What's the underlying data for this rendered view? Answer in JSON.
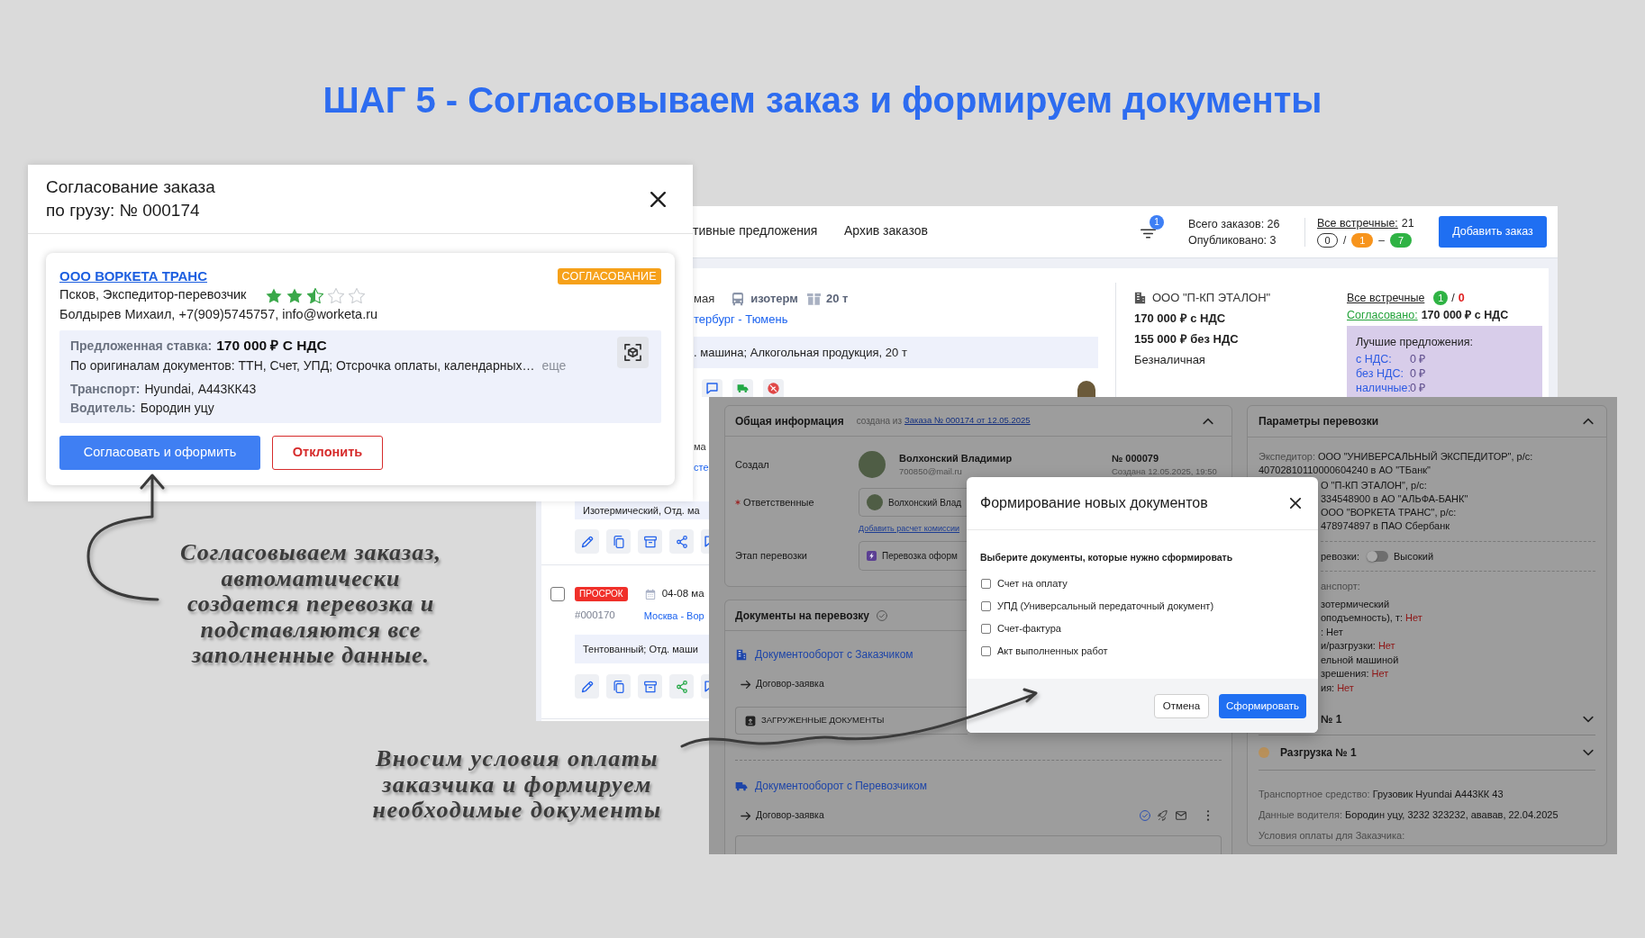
{
  "title": "ШАГ 5 - Согласовываем заказ и формируем документы",
  "approval_dialog": {
    "title": "Согласование заказа\nпо грузу: № 000174",
    "offer": {
      "company": "ООО ВОРКЕТА ТРАНС",
      "status": "СОГЛАСОВАНИЕ",
      "description": "Псков, Экспедитор-перевозчик",
      "stars": 2.5,
      "contact": "Болдырев Михаил, +7(909)5745757, info@worketa.ru",
      "rate_label": "Предложенная ставка:",
      "rate": "170 000 ₽ С НДС",
      "terms": "По оригиналам документов: ТТН, Счет, УПД; Отсрочка оплаты, календарных…",
      "more": "еще",
      "details": [
        {
          "label": "Транспорт:",
          "value": "Hyundai, А443КК43"
        },
        {
          "label": "Водитель:",
          "value": "Бородин уцу"
        }
      ]
    },
    "buttons": [
      {
        "label": "Согласовать и оформить",
        "kind": "primary"
      },
      {
        "label": "Отклонить",
        "kind": "danger"
      }
    ]
  },
  "orders_page": {
    "tabs": [
      {
        "label": "тивные предложения",
        "selected": false
      },
      {
        "label": "Архив заказов",
        "selected": false
      }
    ],
    "filter_count": "1",
    "stats": [
      "Всего заказов: 26",
      "Опубликовано: 3"
    ],
    "counter_offers": {
      "label": "Все встречные:",
      "count": "21",
      "chips": [
        {
          "kind": "outline",
          "value": "0"
        },
        {
          "kind": "separator",
          "value": "/"
        },
        {
          "kind": "filled",
          "value": "1",
          "color": "#f7941d"
        },
        {
          "kind": "separator",
          "value": "–"
        },
        {
          "kind": "filled",
          "value": "7",
          "color": "#2fb344"
        }
      ]
    },
    "add_button": "Добавить заказ",
    "order": {
      "date": "мая",
      "body_type": "изотерм",
      "capacity": "20 т",
      "route": "тербург - Тюмень",
      "cargo": ". машина; Алкогольная продукция, 20 т",
      "actions": [
        {
          "kind": "chat"
        },
        {
          "kind": "truck"
        },
        {
          "kind": "cancel"
        }
      ],
      "customer": "ООО \"П-КП ЭТАЛОН\"",
      "prices": [
        "170 000 ₽ с НДС",
        "155 000 ₽ без НДС"
      ],
      "payment": "Безналичная",
      "counters": {
        "label": "Все встречные",
        "accepted": "1",
        "separator": "/",
        "rejected": "0"
      },
      "agreed": {
        "label": "Согласовано:",
        "value": "170 000 ₽ с НДС"
      },
      "best_offers": {
        "title": "Лучшие предложения:",
        "rows": [
          {
            "label": "с НДС:",
            "value": "0 ₽"
          },
          {
            "label": "без НДС:",
            "value": "0 ₽"
          },
          {
            "label": "наличные:",
            "value": "0 ₽"
          }
        ]
      }
    },
    "order_fragment": {
      "date": "ма",
      "route": "сте",
      "cargo": "Изотермический, Отд. ма",
      "actions": [
        {
          "kind": "edit",
          "highlighted": false
        },
        {
          "kind": "copy",
          "highlighted": false
        },
        {
          "kind": "archive",
          "highlighted": false
        },
        {
          "kind": "share",
          "highlighted": false
        },
        {
          "kind": "chat",
          "highlighted": false
        }
      ]
    },
    "overdue_order": {
      "checked": false,
      "status": "ПРОСРОК",
      "date": "04-08 ма",
      "number": "#000170",
      "route": "Москва - Вор",
      "cargo": "Тентованный; Отд. маши",
      "actions": [
        {
          "kind": "edit",
          "highlighted": false
        },
        {
          "kind": "copy",
          "highlighted": false
        },
        {
          "kind": "archive",
          "highlighted": false
        },
        {
          "kind": "share",
          "highlighted": true
        },
        {
          "kind": "chat",
          "highlighted": false
        }
      ]
    }
  },
  "transport_page": {
    "general_info": {
      "title": "Общая информация",
      "expanded": true,
      "source_prefix": "создана из",
      "source_link": "Заказа № 000174 от 12.05.2025",
      "creator_label": "Создал",
      "creator_name": "Волхонский Владимир",
      "creator_email": "700850@mail.ru",
      "number": "№ 000079",
      "created": "Создана 12.05.2025, 19:50",
      "responsible_label": "Ответственные",
      "required": true,
      "responsible": "Волхонский Влад",
      "add_commission": "Добавить расчет комиссии",
      "stage_label": "Этап перевозки",
      "stage": "Перевозка оформ"
    },
    "documents": {
      "title": "Документы на перевозку",
      "groups": [
        {
          "kind": "customer",
          "title": "Документооборот с Заказчиком",
          "items": [
            "Договор-заявка"
          ],
          "uploads": "ЗАГРУЖЕННЫЕ ДОКУМЕНТЫ"
        },
        {
          "kind": "carrier",
          "title": "Документооборот с Перевозчиком",
          "items": [
            "Договор-заявка"
          ]
        }
      ]
    },
    "params": {
      "title": "Параметры перевозки",
      "expanded": true,
      "expeditor": {
        "label": "Экспедитор:",
        "lines": [
          "ООО \"УНИВЕРСАЛЬНЫЙ ЭКСПЕДИТОР\", р/с:",
          "40702810110000604240 в АО \"ТБанк\""
        ]
      },
      "account_lines": [
        "О \"П-КП ЭТАЛОН\", р/с:",
        "334548900 в АО \"АЛЬФА-БАНК\"",
        "ООО \"ВОРКЕТА ТРАНС\", р/с:",
        "478974897 в ПАО Сбербанк"
      ],
      "priority": {
        "label": "ревозки:",
        "on": false,
        "value": "Высокий"
      },
      "transport_label": "анспорт:",
      "transport_lines": [
        {
          "text": "зотермический"
        },
        {
          "text": "оподъемность), т:",
          "value": "Нет",
          "warning": true
        },
        {
          "text": ":",
          "value": "Нет",
          "warning": false
        },
        {
          "text": "и/разгрузки:",
          "value": "Нет",
          "warning": true
        },
        {
          "text": "ельной машиной"
        },
        {
          "text": "зрешения:",
          "value": "Нет",
          "warning": true
        },
        {
          "text": "ия:",
          "value": "Нет",
          "warning": true
        }
      ],
      "stops": [
        {
          "title": "№ 1",
          "expanded": false
        },
        {
          "title": "Разгрузка № 1",
          "expanded": false,
          "color": "#b8905a"
        }
      ],
      "details": [
        {
          "label": "Транспортное средство:",
          "value": "Грузовик Hyundai А443КК 43"
        },
        {
          "label": "Данные водителя:",
          "value": "Бородин уцу, 3232 323232, ававав, 22.04.2025"
        },
        {
          "label": "Условия оплаты для Заказчика:"
        }
      ]
    },
    "modal": {
      "title": "Формирование новых документов",
      "prompt": "Выберите документы, которые нужно сформировать",
      "options": [
        {
          "label": "Счет на оплату",
          "checked": false
        },
        {
          "label": "УПД (Универсальный передаточный документ)",
          "checked": false
        },
        {
          "label": "Счет-фактура",
          "checked": false
        },
        {
          "label": "Акт выполненных работ",
          "checked": false
        }
      ],
      "buttons": [
        {
          "label": "Отмена",
          "kind": "secondary"
        },
        {
          "label": "Сформировать",
          "kind": "primary"
        }
      ]
    }
  },
  "annotations": [
    "Согласовываем заказаз,\nавтоматически\nсоздается перевозка и\nподставляются все\nзаполненные данные.",
    "Вносим условия оплаты\nзаказчика и формируем\nнеобходимые документы"
  ]
}
